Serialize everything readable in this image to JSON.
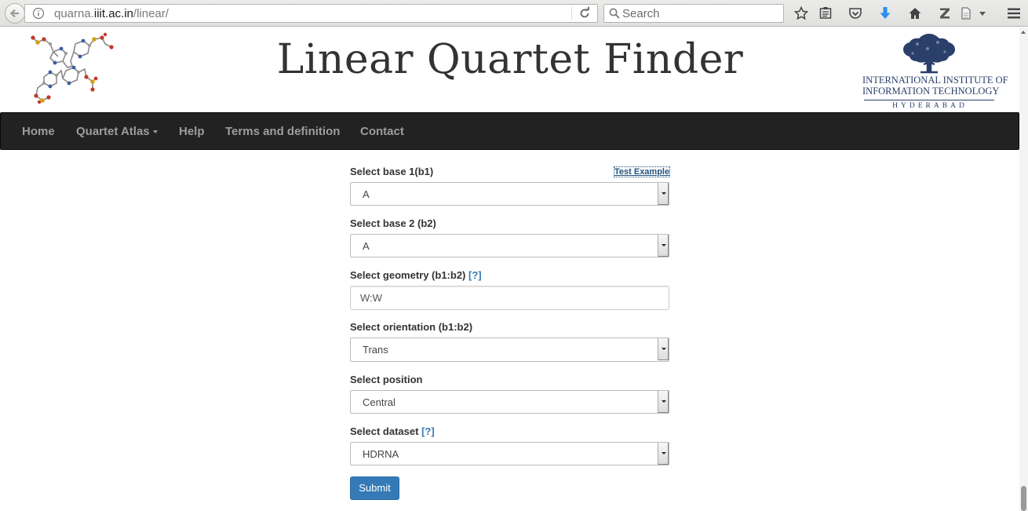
{
  "browser": {
    "url_host": "quarna.",
    "url_domain": "iiit.ac.in",
    "url_path": "/linear/",
    "search_placeholder": "Search",
    "toolbar_icons": [
      "bookmark-star-icon",
      "reading-list-icon",
      "pocket-icon",
      "downloads-icon",
      "home-icon",
      "zotero-icon",
      "page-icon",
      "menu-icon"
    ],
    "download_color": "#2a8ef0"
  },
  "header": {
    "title": "Linear Quartet Finder",
    "logo_line1": "INTERNATIONAL INSTITUTE OF",
    "logo_line2": "INFORMATION TECHNOLOGY",
    "logo_line3": "HYDERABAD"
  },
  "nav": {
    "home": "Home",
    "quartet_atlas": "Quartet Atlas",
    "help": "Help",
    "terms": "Terms and definition",
    "contact": "Contact"
  },
  "form": {
    "test_example": "Test Example",
    "base1": {
      "label": "Select base 1(b1)",
      "value": "A"
    },
    "base2": {
      "label": "Select base 2 (b2)",
      "value": "A"
    },
    "geometry": {
      "label": "Select geometry (b1:b2)",
      "help": "[?]",
      "value": "W:W"
    },
    "orientation": {
      "label": "Select orientation (b1:b2)",
      "value": "Trans"
    },
    "position": {
      "label": "Select position",
      "value": "Central"
    },
    "dataset": {
      "label": "Select dataset",
      "help": "[?]",
      "value": "HDRNA"
    },
    "submit": "Submit"
  },
  "colors": {
    "navbar_bg": "#222222",
    "primary_button": "#337ab7",
    "link": "#337ab7",
    "logo_navy": "#2a3f69"
  }
}
